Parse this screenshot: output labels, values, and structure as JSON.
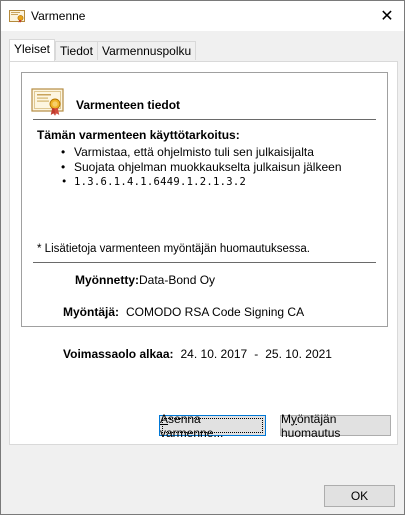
{
  "window": {
    "title": "Varmenne",
    "close_symbol": "✕",
    "icons": {
      "title": "certificate-icon",
      "close": "close-icon"
    }
  },
  "tabs": [
    {
      "label": "Yleiset",
      "active": true
    },
    {
      "label": "Tiedot",
      "active": false
    },
    {
      "label": "Varmennuspolku",
      "active": false
    }
  ],
  "general": {
    "heading": "Varmenteen tiedot",
    "icon": "certificate-icon",
    "purpose_title": "Tämän varmenteen käyttötarkoitus:",
    "purposes": [
      "Varmistaa, että ohjelmisto tuli sen julkaisijalta",
      "Suojata ohjelman muokkaukselta julkaisun jälkeen",
      "1.3.6.1.4.1.6449.1.2.1.3.2"
    ],
    "note": "* Lisätietoja varmenteen myöntäjän huomautuksessa.",
    "issued_to_label": "Myönnetty:",
    "issued_to_value": "Data-Bond Oy",
    "issued_by_label": "Myöntäjä:",
    "issued_by_value": "COMODO RSA Code Signing CA",
    "valid_label": "Voimassaolo alkaa:",
    "valid_from": "24. 10. 2017",
    "valid_separator": "-",
    "valid_to": "25. 10. 2021"
  },
  "buttons": {
    "install_accel": "A",
    "install_rest": "senna varmenne...",
    "issuer_stmt_pre": "M",
    "issuer_stmt_accel": "y",
    "issuer_stmt_rest": "öntäjän huomautus",
    "ok": "OK"
  },
  "colors": {
    "accent": "#0078d7",
    "window_bg": "#f0f0f0",
    "button_bg": "#e1e1e1"
  }
}
